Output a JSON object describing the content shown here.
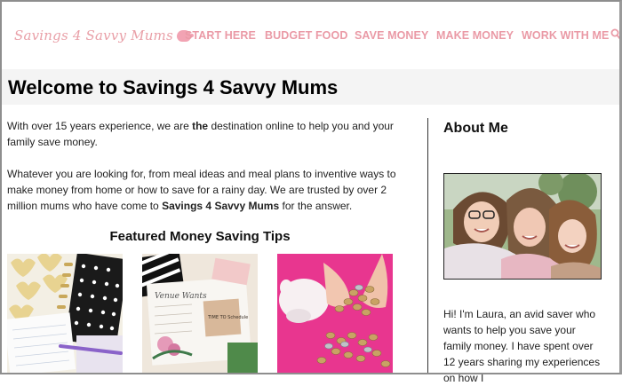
{
  "header": {
    "logo_text": "Savings 4 Savvy Mums",
    "nav": [
      {
        "label": "START HERE"
      },
      {
        "label": "BUDGET FOOD"
      },
      {
        "label": "SAVE MONEY"
      },
      {
        "label": "MAKE MONEY"
      },
      {
        "label": "WORK WITH ME"
      }
    ],
    "search_icon": "search-icon"
  },
  "page": {
    "title": "Welcome to Savings 4 Savvy Mums"
  },
  "intro": {
    "p1_a": "With over 15 years experience, we are ",
    "p1_b": "the",
    "p1_c": " destination online to help you and your family save money.",
    "p2_a": "Whatever you are looking for, from meal ideas and meal plans to inventive ways to make money from home or how to save for a rainy day. We are trusted by over 2 million mums who have come to ",
    "p2_b": "Savings 4 Savvy Mums",
    "p2_c": " for the answer."
  },
  "featured": {
    "heading": "Featured Money Saving Tips",
    "thumb1_text": "",
    "thumb2_text": "Venue Wants",
    "thumb2_note": "TIME TO Schedule"
  },
  "sidebar": {
    "about_title": "About Me",
    "bio": "Hi! I'm Laura, an avid saver who wants to help you save your family money. I have spent over 12 years sharing my experiences on how I"
  },
  "colors": {
    "nav_pink": "#ea9aa6",
    "logo_pink": "#e9a0a8",
    "title_band": "#f4f4f4",
    "thumb3_pink": "#e8378f"
  }
}
